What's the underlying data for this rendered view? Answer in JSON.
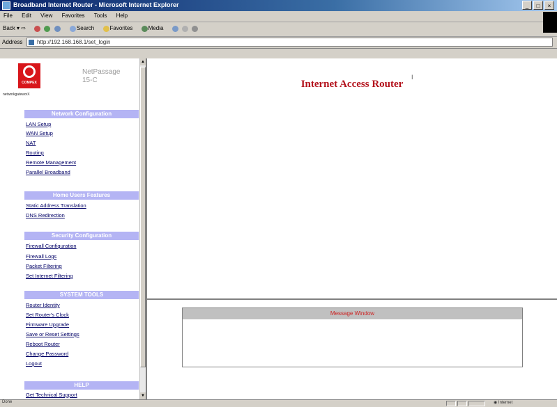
{
  "window": {
    "title": "Broadband Internet Router - Microsoft Internet Explorer",
    "buttons": [
      "_",
      "□",
      "×"
    ]
  },
  "menubar": {
    "items": [
      "File",
      "Edit",
      "View",
      "Favorites",
      "Tools",
      "Help"
    ]
  },
  "toolbar": {
    "back": "Back",
    "search": "Search",
    "favorites": "Favorites",
    "media": "Media"
  },
  "address": {
    "label": "Address",
    "url": "http://192.168.168.1/set_login"
  },
  "sidebar": {
    "logo_text": "COMPEX",
    "product_name": "NetPassage",
    "product_model": "15-C",
    "brand_small": "networkgateworX",
    "sections": [
      {
        "title": "Network Configuration",
        "links": [
          "LAN Setup",
          "WAN Setup",
          "NAT",
          "Routing",
          "Remote Management",
          "Parallel Broadband"
        ]
      },
      {
        "title": "Home Users Features",
        "links": [
          "Static Address Translation",
          "DNS Redirection"
        ]
      },
      {
        "title": "Security Configuration",
        "links": [
          "Firewall Configuration",
          "Firewall Logs",
          "Packet Filtering",
          "Set Internet Filtering"
        ]
      },
      {
        "title": "SYSTEM TOOLS",
        "links": [
          "Router Identity",
          "Set Router's Clock",
          "Firmware Upgrade",
          "Save or Reset Settings",
          "Reboot Router",
          "Change Password",
          "Logout"
        ]
      },
      {
        "title": "HELP",
        "links": [
          "Get Technical Support"
        ]
      }
    ]
  },
  "main": {
    "title": "Internet Access Router",
    "message_window_title": "Message Window"
  },
  "statusbar": {
    "text": "Done",
    "zone": "Internet"
  }
}
